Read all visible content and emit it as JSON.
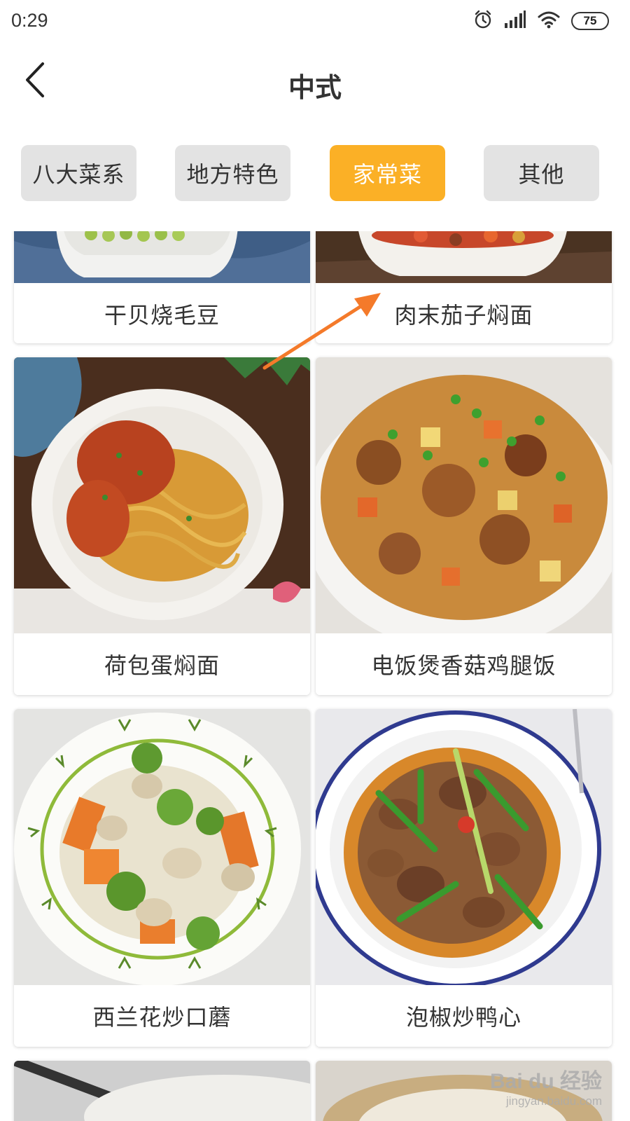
{
  "status_bar": {
    "time": "0:29",
    "battery": "75",
    "icons": [
      "alarm-icon",
      "signal-icon",
      "wifi-icon",
      "battery-icon"
    ]
  },
  "header": {
    "title": "中式",
    "back_icon": "chevron-left-icon"
  },
  "tabs": [
    {
      "label": "八大菜系",
      "active": false
    },
    {
      "label": "地方特色",
      "active": false
    },
    {
      "label": "家常菜",
      "active": true
    },
    {
      "label": "其他",
      "active": false
    }
  ],
  "colors": {
    "accent": "#fbb026",
    "tab_inactive": "#e3e3e3",
    "annotation_arrow": "#f47a2a"
  },
  "recipes": [
    {
      "name": "干贝烧毛豆"
    },
    {
      "name": "肉末茄子焖面"
    },
    {
      "name": "荷包蛋焖面"
    },
    {
      "name": "电饭煲香菇鸡腿饭"
    },
    {
      "name": "西兰花炒口蘑"
    },
    {
      "name": "泡椒炒鸭心"
    }
  ],
  "watermark": {
    "brand": "Bai du 经验",
    "url": "jingyan.baidu.com"
  }
}
